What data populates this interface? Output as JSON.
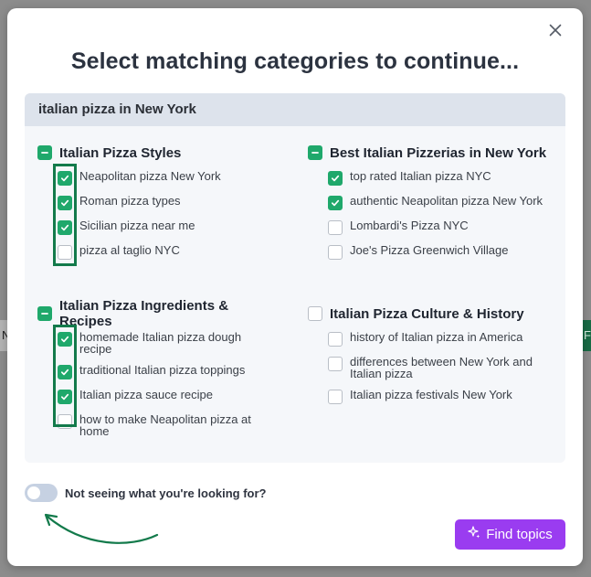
{
  "modal": {
    "title": "Select matching categories to continue...",
    "query": "italian pizza in New York"
  },
  "groups": [
    {
      "title": "Italian Pizza Styles",
      "state": "partial",
      "items": [
        {
          "label": "Neapolitan pizza New York",
          "checked": true
        },
        {
          "label": "Roman pizza types",
          "checked": true
        },
        {
          "label": "Sicilian pizza near me",
          "checked": true
        },
        {
          "label": "pizza al taglio NYC",
          "checked": false
        }
      ]
    },
    {
      "title": "Best Italian Pizzerias in New York",
      "state": "partial",
      "items": [
        {
          "label": "top rated Italian pizza NYC",
          "checked": true
        },
        {
          "label": "authentic Neapolitan pizza New York",
          "checked": true
        },
        {
          "label": "Lombardi's Pizza NYC",
          "checked": false
        },
        {
          "label": "Joe's Pizza Greenwich Village",
          "checked": false
        }
      ]
    },
    {
      "title": "Italian Pizza Ingredients & Recipes",
      "state": "partial",
      "items": [
        {
          "label": "homemade Italian pizza dough recipe",
          "checked": true
        },
        {
          "label": "traditional Italian pizza toppings",
          "checked": true
        },
        {
          "label": "Italian pizza sauce recipe",
          "checked": true
        },
        {
          "label": "how to make Neapolitan pizza at home",
          "checked": false
        }
      ]
    },
    {
      "title": "Italian Pizza Culture & History",
      "state": "unchecked",
      "items": [
        {
          "label": "history of Italian pizza in America",
          "checked": false
        },
        {
          "label": "differences between New York and Italian pizza",
          "checked": false
        },
        {
          "label": "Italian pizza festivals New York",
          "checked": false
        }
      ]
    }
  ],
  "toggle": {
    "label": "Not seeing what you're looking for?",
    "on": false
  },
  "find_button": {
    "label": "Find topics",
    "icon": "sparkle-icon"
  },
  "backdrop": {
    "left_button_text": "N",
    "right_button_text": "F"
  },
  "colors": {
    "check_green": "#1fa86b",
    "highlight_green": "#137a4b",
    "find_purple": "#9a3cf0",
    "panel_header": "#dde3ec"
  }
}
